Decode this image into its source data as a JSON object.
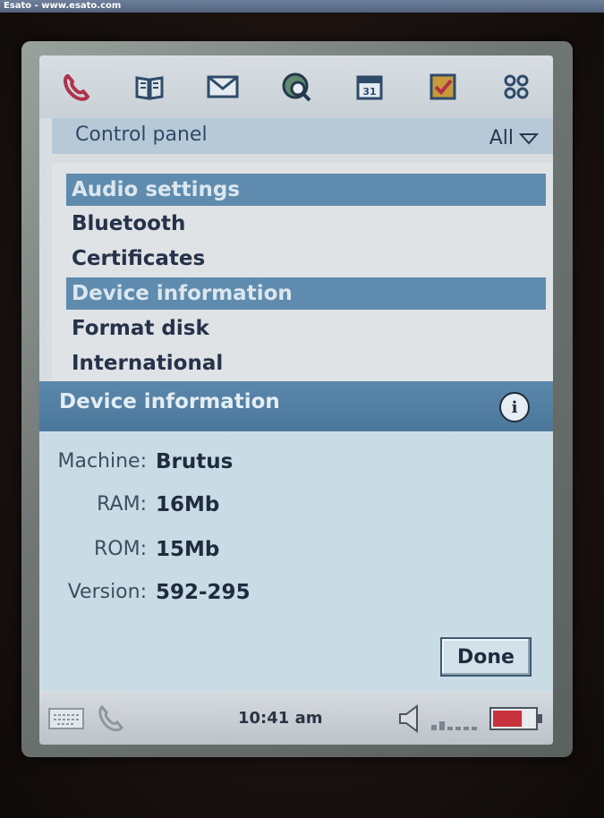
{
  "watermark": "Esato - www.esato.com",
  "appbar": {
    "icons": [
      "phone-icon",
      "contacts-book-icon",
      "messaging-envelope-icon",
      "web-globe-icon",
      "calendar-icon",
      "tasks-checkbox-icon",
      "applications-grid-icon"
    ]
  },
  "header": {
    "title": "Control panel",
    "filter_label": "All"
  },
  "list": {
    "items": [
      {
        "label": "Audio settings",
        "selected": true
      },
      {
        "label": "Bluetooth",
        "selected": false
      },
      {
        "label": "Certificates",
        "selected": false
      },
      {
        "label": "Device information",
        "selected": true
      },
      {
        "label": "Format disk",
        "selected": false
      },
      {
        "label": "International",
        "selected": false
      }
    ]
  },
  "dialog": {
    "title": "Device information",
    "fields": [
      {
        "label": "Machine:",
        "value": "Brutus"
      },
      {
        "label": "RAM:",
        "value": "16Mb"
      },
      {
        "label": "ROM:",
        "value": "15Mb"
      },
      {
        "label": "Version:",
        "value": "592-295"
      }
    ],
    "done_label": "Done"
  },
  "statusbar": {
    "time": "10:41 am",
    "icons": [
      "keyboard-icon",
      "phone-handset-icon",
      "speaker-icon",
      "signal-strength-icon",
      "battery-icon"
    ]
  },
  "colors": {
    "selection": "#5f8cae",
    "dialog_header": "#4b779b",
    "dialog_bg": "#c9dce6",
    "text_dark": "#1f2c3e"
  }
}
